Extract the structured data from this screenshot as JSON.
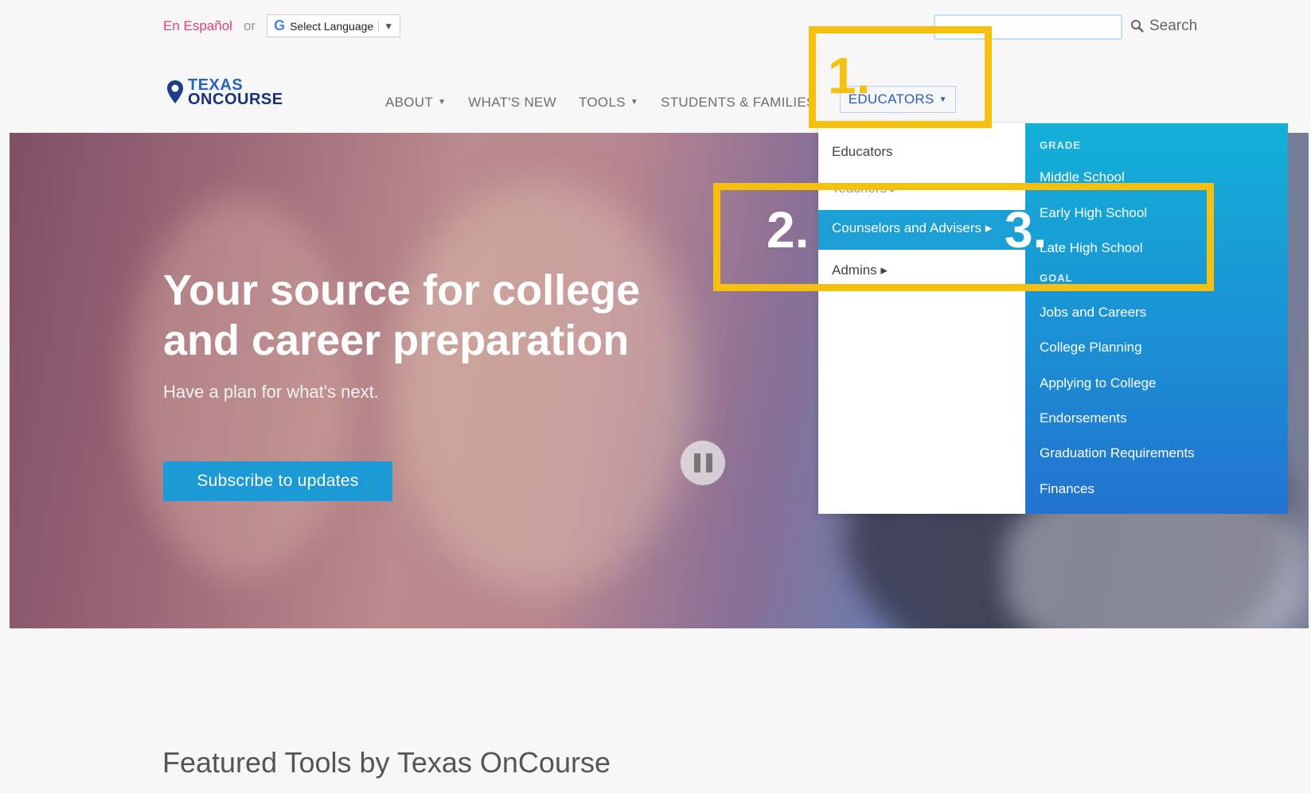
{
  "utility": {
    "espanol": "En Español",
    "or": "or",
    "translate_label": "Select Language",
    "search_label": "Search",
    "search_placeholder": ""
  },
  "logo": {
    "line1": "TEXAS",
    "line2": "ONCOURSE"
  },
  "nav": {
    "items": [
      {
        "label": "ABOUT",
        "caret": true
      },
      {
        "label": "WHAT'S NEW",
        "caret": false
      },
      {
        "label": "TOOLS",
        "caret": true
      },
      {
        "label": "STUDENTS & FAMILIES",
        "caret": false
      },
      {
        "label": "EDUCATORS",
        "caret": true,
        "active": true
      }
    ]
  },
  "hero": {
    "title": "Your source for college and career preparation",
    "subtitle": "Have a plan for what's next.",
    "subscribe_label": "Subscribe to updates"
  },
  "dropdown": {
    "left": [
      "Educators",
      "Teachers ▸",
      "Counselors and Advisers ▸",
      "Admins ▸"
    ],
    "right": {
      "grade_heading": "GRADE",
      "grade_links": [
        "Middle School",
        "Early High School",
        "Late High School"
      ],
      "goal_heading": "GOAL",
      "goal_links": [
        "Jobs and Careers",
        "College Planning",
        "Applying to College",
        "Endorsements",
        "Graduation Requirements",
        "Finances"
      ]
    }
  },
  "annotations": {
    "n1": "1.",
    "n2": "2.",
    "n3": "3.",
    "color": "#f5c010"
  },
  "featured_heading": "Featured Tools by Texas OnCourse"
}
